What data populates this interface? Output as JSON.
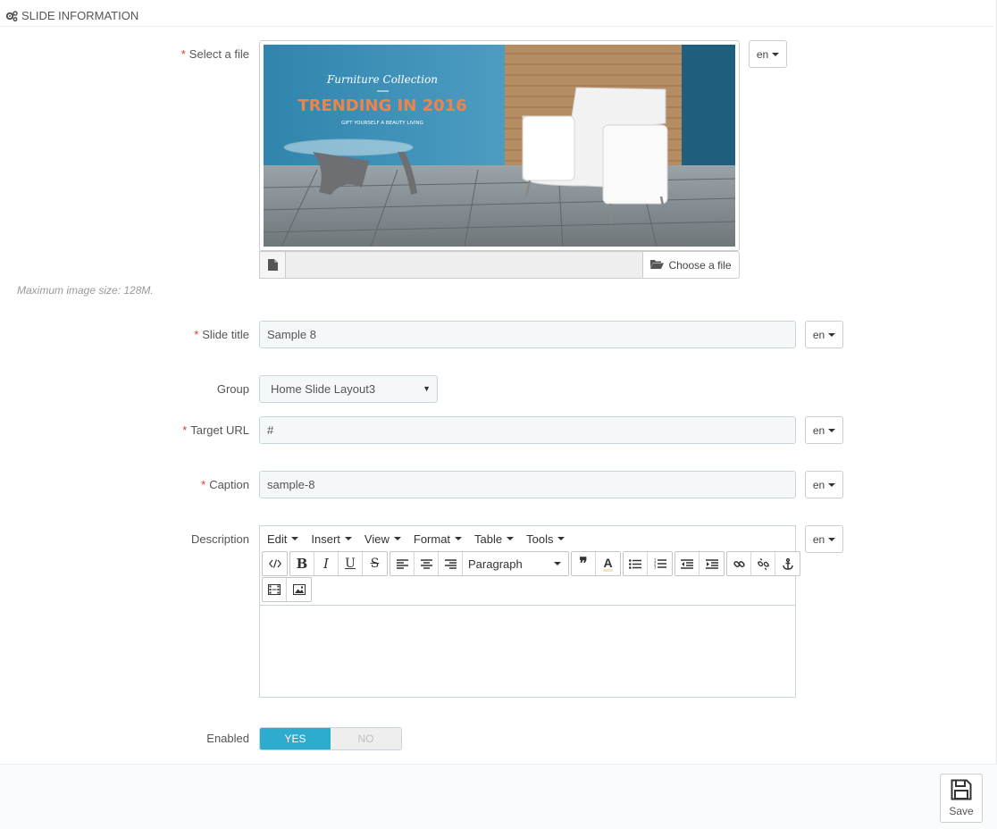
{
  "panel": {
    "heading": "SLIDE INFORMATION",
    "heading_icon": "cogs-icon"
  },
  "fields": {
    "file": {
      "label": "Select a file",
      "lang": "en",
      "choose_label": "Choose a file",
      "help": "Maximum image size: 128M."
    },
    "banner": {
      "script_title": "Furniture Collection",
      "headline": "TRENDING IN 2016",
      "subline": "GIFT YOURSELF A BEAUTY LIVING"
    },
    "title": {
      "label": "Slide title",
      "value": "Sample 8",
      "lang": "en"
    },
    "group": {
      "label": "Group",
      "value": "Home Slide Layout3"
    },
    "url": {
      "label": "Target URL",
      "value": "#",
      "lang": "en"
    },
    "caption": {
      "label": "Caption",
      "value": "sample-8",
      "lang": "en"
    },
    "description": {
      "label": "Description",
      "lang": "en",
      "menus": [
        "Edit",
        "Insert",
        "View",
        "Format",
        "Table",
        "Tools"
      ],
      "format_select": "Paragraph"
    },
    "enabled": {
      "label": "Enabled",
      "yes": "YES",
      "no": "NO",
      "value": true
    }
  },
  "footer": {
    "save_label": "Save"
  },
  "colors": {
    "accent": "#2eacce",
    "required": "#e4352b",
    "banner_blue": "#3a8fb5",
    "banner_orange": "#f0834a"
  }
}
